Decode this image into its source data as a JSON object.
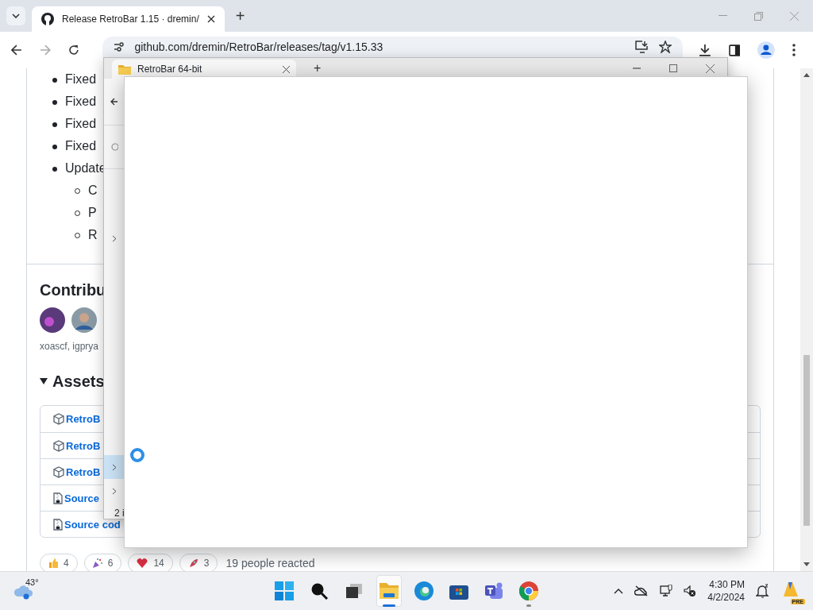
{
  "browser": {
    "tabs": [
      {
        "title": "Release RetroBar 1.15 · dremin/",
        "selected": true
      }
    ],
    "new_tab": "+",
    "address": "github.com/dremin/RetroBar/releases/tag/v1.15.33"
  },
  "page": {
    "notes": [
      {
        "text": "Fixed"
      },
      {
        "text": "Fixed"
      },
      {
        "text": "Fixed"
      },
      {
        "text": "Fixed"
      },
      {
        "text": "Update",
        "children": [
          {
            "text": "C"
          },
          {
            "text": "P"
          },
          {
            "text": "R"
          }
        ]
      }
    ],
    "contributors": {
      "heading": "Contribu",
      "names": "xoascf, igprya"
    },
    "assets": {
      "heading": "Assets",
      "expanded": true,
      "items": [
        {
          "kind": "package",
          "name": "RetroB"
        },
        {
          "kind": "package",
          "name": "RetroB"
        },
        {
          "kind": "package",
          "name": "RetroB"
        },
        {
          "kind": "zip",
          "name": "Source"
        },
        {
          "kind": "zip",
          "name": "Source cod"
        }
      ]
    },
    "reactions": [
      {
        "kind": "thumbs",
        "count": "4"
      },
      {
        "kind": "party",
        "count": "6"
      },
      {
        "kind": "heart",
        "count": "14"
      },
      {
        "kind": "rocket",
        "count": "3"
      }
    ],
    "reacted": "19 people reacted"
  },
  "explorer": {
    "tab": "RetroBar 64-bit",
    "new_tab": "+",
    "nav_rows": [
      {
        "selected": false
      },
      {
        "selected": true
      },
      {
        "selected": false
      }
    ],
    "status": "2 i"
  },
  "dialog": {
    "loading": true
  },
  "taskbar": {
    "weather": "43°",
    "apps": [
      {
        "kind": "start",
        "running": false,
        "focused": false
      },
      {
        "kind": "search",
        "running": false,
        "focused": false
      },
      {
        "kind": "taskview",
        "running": false,
        "focused": false
      },
      {
        "kind": "explorer",
        "running": true,
        "focused": true
      },
      {
        "kind": "edge",
        "running": false,
        "focused": false
      },
      {
        "kind": "store",
        "running": false,
        "focused": false
      },
      {
        "kind": "teams",
        "running": false,
        "focused": false
      },
      {
        "kind": "chrome",
        "running": true,
        "focused": false
      }
    ],
    "time": "4:30 PM",
    "date": "4/2/2024",
    "copilot_badge": "PRE"
  }
}
